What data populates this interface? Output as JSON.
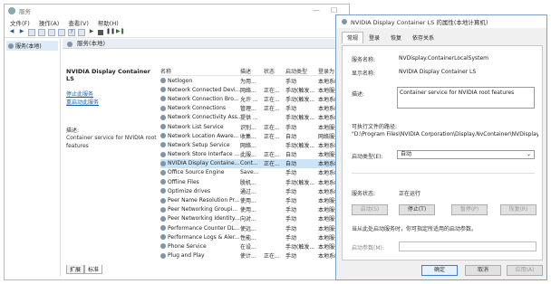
{
  "services_window": {
    "title": "服务",
    "menu": [
      "文件(F)",
      "操作(A)",
      "查看(V)",
      "帮助(H)"
    ],
    "tree_item": "服务(本地)",
    "pane_header": "服务(本地)",
    "selected_service_name": "NVIDIA Display Container LS",
    "action_stop": "停止此服务",
    "action_restart": "重启动此服务",
    "desc_label": "描述:",
    "desc_text": "Container service for NVIDIA root features",
    "columns": [
      "名称",
      "描述",
      "状态",
      "启动类型",
      "登录为"
    ],
    "rows": [
      {
        "name": "Netlogon",
        "desc": "为用...",
        "status": "",
        "startup": "手动",
        "logon": "本地系统"
      },
      {
        "name": "Network Connected Devi...",
        "desc": "网络...",
        "status": "正在...",
        "startup": "手动(触发...",
        "logon": "本地服务"
      },
      {
        "name": "Network Connection Bro...",
        "desc": "允许 ...",
        "status": "正在...",
        "startup": "手动(触发...",
        "logon": "本地系统"
      },
      {
        "name": "Network Connections",
        "desc": "管理...",
        "status": "正在...",
        "startup": "手动",
        "logon": "本地系统"
      },
      {
        "name": "Network Connectivity Ass...",
        "desc": "提供 ...",
        "status": "",
        "startup": "手动(触发...",
        "logon": "本地系统"
      },
      {
        "name": "Network List Service",
        "desc": "识别...",
        "status": "正在...",
        "startup": "手动",
        "logon": "本地服务"
      },
      {
        "name": "Network Location Aware...",
        "desc": "收集...",
        "status": "正在...",
        "startup": "自动",
        "logon": "网络服务"
      },
      {
        "name": "Network Setup Service",
        "desc": "网络...",
        "status": "",
        "startup": "手动(触发...",
        "logon": "本地系统"
      },
      {
        "name": "Network Store Interface ...",
        "desc": "此服...",
        "status": "正在...",
        "startup": "自动",
        "logon": "本地服务"
      },
      {
        "name": "NVIDIA Display Containe...",
        "desc": "Cont...",
        "status": "正在...",
        "startup": "自动",
        "logon": "本地系统",
        "selected": true
      },
      {
        "name": "Office Source Engine",
        "desc": "Save...",
        "status": "",
        "startup": "手动",
        "logon": "本地系统"
      },
      {
        "name": "Offline Files",
        "desc": "脱机...",
        "status": "",
        "startup": "手动(触发...",
        "logon": "本地系统"
      },
      {
        "name": "Optimize drives",
        "desc": "通过...",
        "status": "",
        "startup": "手动",
        "logon": "本地系统"
      },
      {
        "name": "Peer Name Resolution Pr...",
        "desc": "使用...",
        "status": "",
        "startup": "手动",
        "logon": "本地服务"
      },
      {
        "name": "Peer Networking Groupi...",
        "desc": "使用...",
        "status": "",
        "startup": "手动",
        "logon": "本地服务"
      },
      {
        "name": "Peer Networking Identity...",
        "desc": "向对...",
        "status": "",
        "startup": "手动",
        "logon": "本地服务"
      },
      {
        "name": "Performance Counter DL...",
        "desc": "使远...",
        "status": "",
        "startup": "手动",
        "logon": "本地服务"
      },
      {
        "name": "Performance Logs & Aler...",
        "desc": "性能...",
        "status": "",
        "startup": "手动",
        "logon": "本地服务"
      },
      {
        "name": "Phone Service",
        "desc": "在设...",
        "status": "",
        "startup": "手动(触发...",
        "logon": "本地服务"
      },
      {
        "name": "Plug and Play",
        "desc": "使计...",
        "status": "正在...",
        "startup": "手动",
        "logon": "本地系统"
      }
    ],
    "bottom_tabs": [
      "扩展",
      "标准"
    ]
  },
  "dialog": {
    "title": "NVIDIA Display Container LS 的属性(本地计算机)",
    "tabs": [
      "常规",
      "登录",
      "恢复",
      "依存关系"
    ],
    "service_name_label": "服务名称:",
    "service_name_value": "NVDisplay.ContainerLocalSystem",
    "display_name_label": "显示名称:",
    "display_name_value": "NVIDIA Display Container LS",
    "description_label": "描述:",
    "description_value": "Container service for NVIDIA root features",
    "exe_path_label": "可执行文件的路径:",
    "exe_path_value": "\"D:\\Program Files\\NVIDIA Corporation\\Display.NvContainer\\NVDisplay.",
    "startup_type_label": "启动类型(E):",
    "startup_type_value": "自动",
    "status_label": "服务状态:",
    "status_value": "正在运行",
    "btn_start": "启动(S)",
    "btn_stop": "停止(T)",
    "btn_pause": "暂停(P)",
    "btn_resume": "恢复(R)",
    "hint": "当从此处启动服务时，你可指定所适用的启动参数。",
    "params_label": "启动参数(M):",
    "ok": "确定",
    "cancel": "取消",
    "apply": "应用(A)"
  }
}
